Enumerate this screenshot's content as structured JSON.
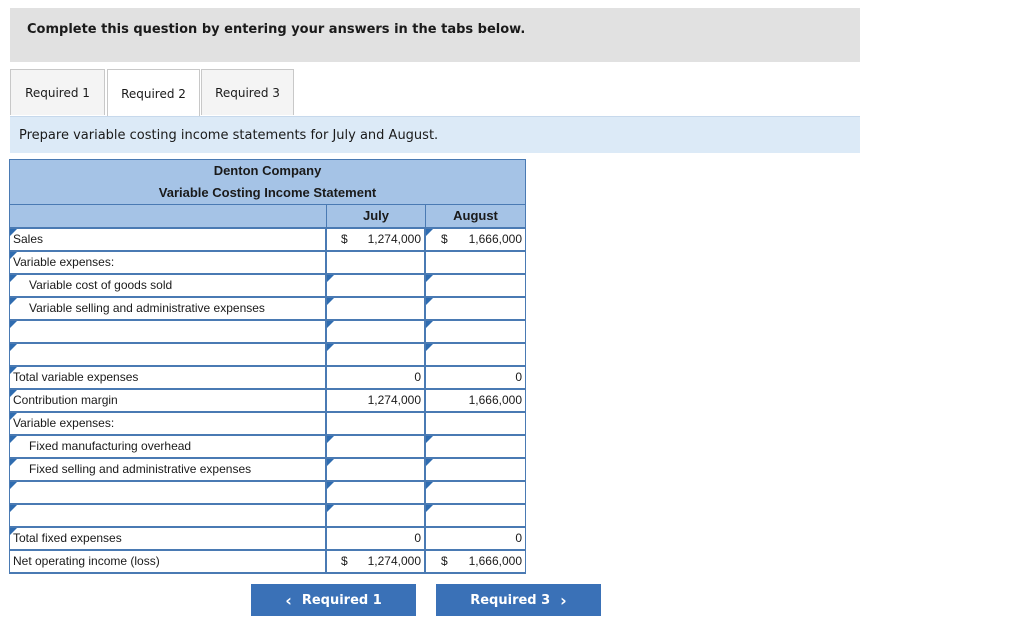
{
  "header": {
    "instruction": "Complete this question by entering your answers in the tabs below."
  },
  "tabs": [
    {
      "label": "Required 1",
      "active": false
    },
    {
      "label": "Required 2",
      "active": true
    },
    {
      "label": "Required 3",
      "active": false
    }
  ],
  "prompt": "Prepare variable costing income statements for July and August.",
  "statement": {
    "company": "Denton Company",
    "title": "Variable Costing Income Statement",
    "columns": [
      "July",
      "August"
    ],
    "rows": {
      "sales": {
        "label": "Sales",
        "july_symbol": "$",
        "july": "1,274,000",
        "aug_symbol": "$",
        "aug": "1,666,000"
      },
      "var_header": {
        "label": "Variable expenses:"
      },
      "var_cogs": {
        "label": "Variable cost of goods sold",
        "july": "",
        "aug": ""
      },
      "var_sga": {
        "label": "Variable selling and administrative expenses",
        "july": "",
        "aug": ""
      },
      "blank1": {
        "label": "",
        "july": "",
        "aug": ""
      },
      "blank2": {
        "label": "",
        "july": "",
        "aug": ""
      },
      "total_var": {
        "label": "Total variable expenses",
        "july": "0",
        "aug": "0"
      },
      "contribution": {
        "label": "Contribution margin",
        "july": "1,274,000",
        "aug": "1,666,000"
      },
      "fixed_header": {
        "label": "Variable expenses:"
      },
      "fixed_mfg": {
        "label": "Fixed manufacturing overhead",
        "july": "",
        "aug": ""
      },
      "fixed_sga": {
        "label": "Fixed selling and administrative expenses",
        "july": "",
        "aug": ""
      },
      "blank3": {
        "label": "",
        "july": "",
        "aug": ""
      },
      "blank4": {
        "label": "",
        "july": "",
        "aug": ""
      },
      "total_fixed": {
        "label": "Total fixed expenses",
        "july": "0",
        "aug": "0"
      },
      "net": {
        "label": "Net operating income (loss)",
        "july_symbol": "$",
        "july": "1,274,000",
        "aug_symbol": "$",
        "aug": "1,666,000"
      }
    }
  },
  "nav": {
    "prev_label": "Required 1",
    "next_label": "Required 3",
    "prev_icon": "chevron-left-icon",
    "next_icon": "chevron-right-icon"
  },
  "colors": {
    "accent": "#3a71b7",
    "header_bg": "#a5c3e6",
    "grid": "#4a7ab3",
    "instruction_bg": "#dceaf7"
  }
}
